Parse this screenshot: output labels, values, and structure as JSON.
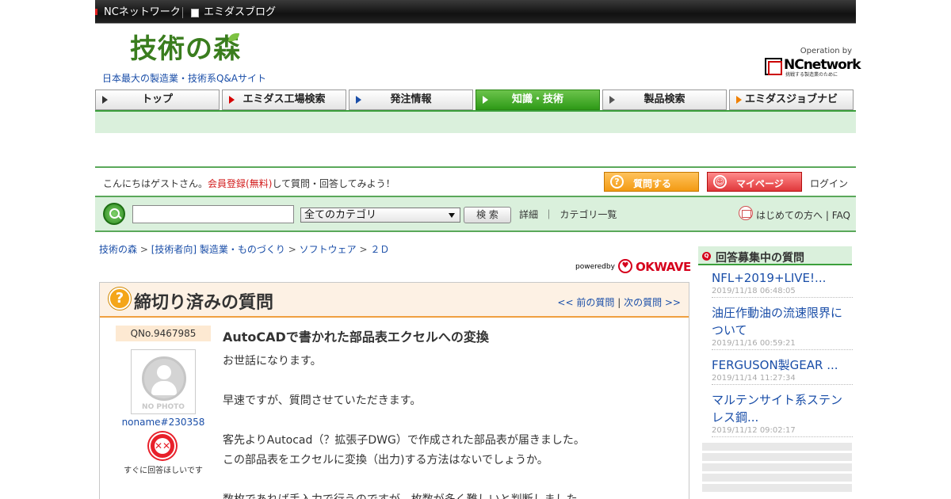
{
  "topbar": {
    "network": "NCネットワーク",
    "blog": "エミダスブログ"
  },
  "header": {
    "logo": "技術の森",
    "tagline": "日本最大の製造業・技術系Q&Aサイト",
    "operation_by": "Operation by",
    "nc_name": "NCnetwork",
    "nc_sub": "挑戦する製造業のために"
  },
  "nav": {
    "tabs": [
      {
        "label": "トップ",
        "arrow_color": "#333333"
      },
      {
        "label": "エミダス工場検索",
        "arrow_color": "#d60000"
      },
      {
        "label": "発注情報",
        "arrow_color": "#1a4ea8"
      },
      {
        "label": "知識・技術",
        "arrow_color": "#ffffff"
      },
      {
        "label": "製品検索",
        "arrow_color": "#555555"
      },
      {
        "label": "エミダスジョブナビ",
        "arrow_color": "#f08000"
      }
    ],
    "active_index": 3
  },
  "greeting": {
    "prefix": "こんにちはゲストさん。",
    "register": "会員登録(無料)",
    "suffix": "して質問・回答してみよう！",
    "ask_button": "質問する",
    "mypage_button": "マイページ",
    "login": "ログイン"
  },
  "search": {
    "input_value": "",
    "category": "全てのカテゴリ",
    "button": "検 索",
    "details": "詳細",
    "categories": "カテゴリ一覧",
    "first_time": "はじめての方へ",
    "faq": "FAQ"
  },
  "breadcrumb": [
    "技術の森",
    "[技術者向] 製造業・ものづくり",
    "ソフトウェア",
    "２Ｄ"
  ],
  "powered": {
    "label": "poweredby",
    "brand": "OKWAVE"
  },
  "question": {
    "header": "締切り済みの質問",
    "prev": "<< 前の質問",
    "next": "次の質問 >>",
    "number": "QNo.9467985",
    "no_photo": "NO PHOTO",
    "user": "noname#230358",
    "mood": "すぐに回答ほしいです",
    "title": "AutoCADで書かれた部品表エクセルへの変換",
    "body": [
      "お世話になります。",
      "",
      "早速ですが、質問させていただきます。",
      "",
      "客先よりAutocad（？拡張子DWG）で作成された部品表が届きました。",
      "この部品表をエクセルに変換（出力)する方法はないでしょうか。",
      "",
      "数枚であれば手入力で行うのですが、枚数が多く難しいと判断しました。"
    ]
  },
  "sidebar": {
    "title": "回答募集中の質問",
    "items": [
      {
        "title": "NFL+2019+LIVE!...",
        "date": "2019/11/18 06:48:05"
      },
      {
        "title": "油圧作動油の流速限界について",
        "date": "2019/11/16 00:59:21"
      },
      {
        "title": "FERGUSON製GEAR ...",
        "date": "2019/11/14 11:27:34"
      },
      {
        "title": "マルテンサイト系ステンレス鋼...",
        "date": "2019/11/12 09:02:17"
      }
    ]
  }
}
